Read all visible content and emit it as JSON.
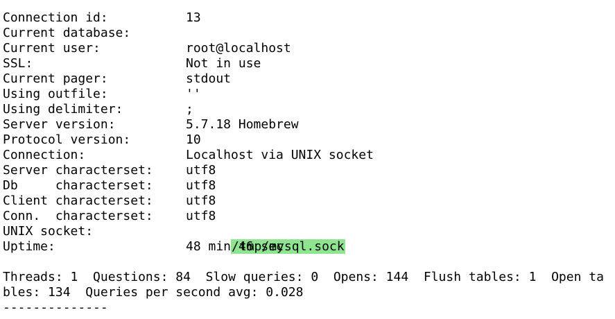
{
  "status": {
    "rows": [
      {
        "label": "Connection id:",
        "value": "13"
      },
      {
        "label": "Current database:",
        "value": ""
      },
      {
        "label": "Current user:",
        "value": "root@localhost"
      },
      {
        "label": "SSL:",
        "value": "Not in use"
      },
      {
        "label": "Current pager:",
        "value": "stdout"
      },
      {
        "label": "Using outfile:",
        "value": "''"
      },
      {
        "label": "Using delimiter:",
        "value": ";"
      },
      {
        "label": "Server version:",
        "value": "5.7.18 Homebrew"
      },
      {
        "label": "Protocol version:",
        "value": "10"
      },
      {
        "label": "Connection:",
        "value": "Localhost via UNIX socket"
      },
      {
        "label": "Server characterset:",
        "value": "utf8"
      },
      {
        "label": "Db     characterset:",
        "value": "utf8"
      },
      {
        "label": "Client characterset:",
        "value": "utf8"
      },
      {
        "label": "Conn.  characterset:",
        "value": "utf8"
      },
      {
        "label": "UNIX socket:",
        "value": "/tmp/mysql.sock",
        "highlight_color": "#8fe48f"
      },
      {
        "label": "Uptime:",
        "value": "48 min 46 sec"
      }
    ]
  },
  "stats": {
    "line1": "Threads: 1  Questions: 84  Slow queries: 0  Opens: 144  Flush tables: 1  Open ta",
    "line2": "bles: 134  Queries per second avg: 0.028",
    "separator": "--------------"
  }
}
